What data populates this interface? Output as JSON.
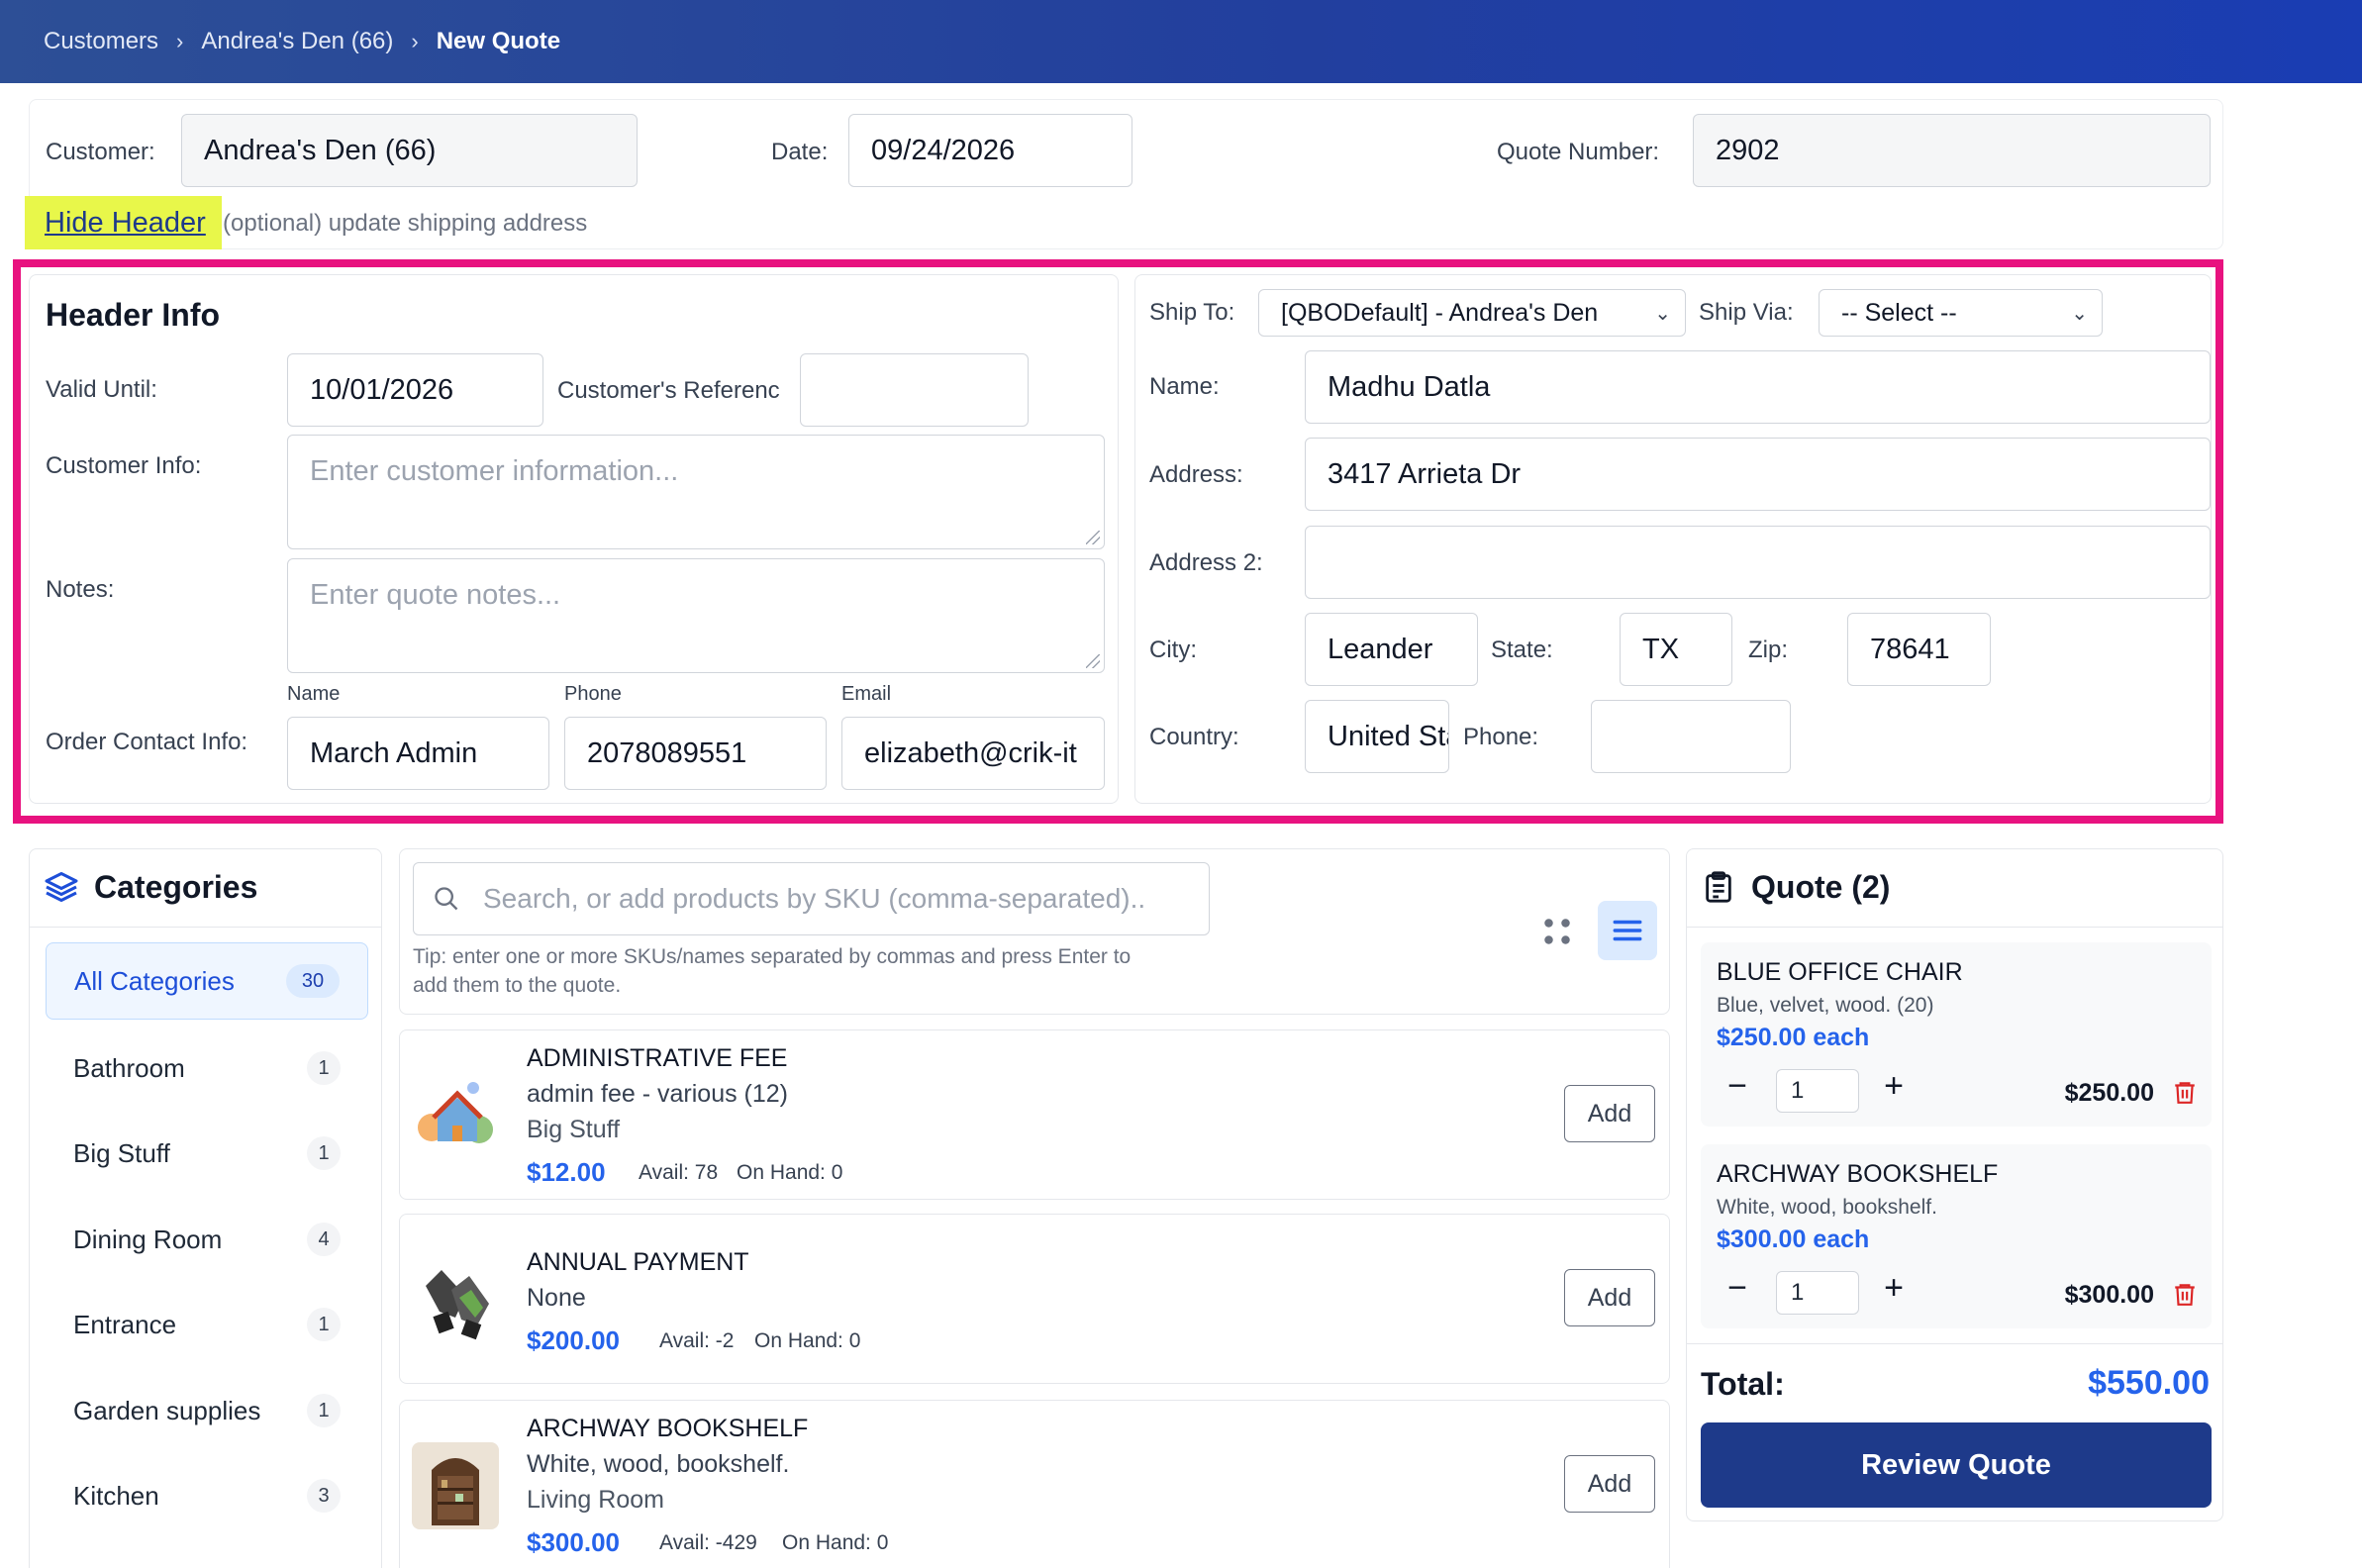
{
  "breadcrumb": [
    "Customers",
    "Andrea's Den (66)",
    "New Quote"
  ],
  "top": {
    "customer_label": "Customer:",
    "customer_value": "Andrea's Den (66)",
    "date_label": "Date:",
    "date_value": "09/24/2026",
    "quote_number_label": "Quote Number:",
    "quote_number_value": "2902",
    "hide_header": "Hide Header",
    "optional_text": "(optional) update shipping address"
  },
  "header_info": {
    "title": "Header Info",
    "valid_until_label": "Valid Until:",
    "valid_until_value": "10/01/2026",
    "customer_ref_label": "Customer's Referenc",
    "customer_ref_value": "",
    "customer_info_label": "Customer Info:",
    "customer_info_placeholder": "Enter customer information...",
    "notes_label": "Notes:",
    "notes_placeholder": "Enter quote notes...",
    "order_contact_label": "Order Contact Info:",
    "name_label": "Name",
    "name_value": "March Admin",
    "phone_label": "Phone",
    "phone_value": "2078089551",
    "email_label": "Email",
    "email_value": "elizabeth@crik-it"
  },
  "shipping": {
    "ship_to_label": "Ship To:",
    "ship_to_value": "[QBODefault] - Andrea's Den",
    "ship_via_label": "Ship Via:",
    "ship_via_value": "-- Select --",
    "name_label": "Name:",
    "name_value": "Madhu Datla",
    "address_label": "Address:",
    "address_value": "3417 Arrieta Dr",
    "address2_label": "Address 2:",
    "address2_value": "",
    "city_label": "City:",
    "city_value": "Leander",
    "state_label": "State:",
    "state_value": "TX",
    "zip_label": "Zip:",
    "zip_value": "78641",
    "country_label": "Country:",
    "country_value": "United States",
    "phone_label": "Phone:",
    "phone_value": ""
  },
  "categories": {
    "title": "Categories",
    "items": [
      {
        "label": "All Categories",
        "count": "30"
      },
      {
        "label": "Bathroom",
        "count": "1"
      },
      {
        "label": "Big Stuff",
        "count": "1"
      },
      {
        "label": "Dining Room",
        "count": "4"
      },
      {
        "label": "Entrance",
        "count": "1"
      },
      {
        "label": "Garden supplies",
        "count": "1"
      },
      {
        "label": "Kitchen",
        "count": "3"
      }
    ]
  },
  "search": {
    "placeholder": "Search, or add products by SKU (comma-separated)..",
    "tip_line1": "Tip: enter one or more SKUs/names separated by commas and press Enter to",
    "tip_line2": "add them to the quote."
  },
  "products": [
    {
      "name": "ADMINISTRATIVE FEE",
      "desc": "admin fee - various (12)",
      "category": "Big Stuff",
      "price": "$12.00",
      "avail": "Avail: 78",
      "on_hand": "On Hand: 0",
      "add": "Add"
    },
    {
      "name": "ANNUAL PAYMENT",
      "desc": "None",
      "category": "",
      "price": "$200.00",
      "avail": "Avail: -2",
      "on_hand": "On Hand: 0",
      "add": "Add"
    },
    {
      "name": "ARCHWAY BOOKSHELF",
      "desc": "White, wood, bookshelf.",
      "category": "Living Room",
      "price": "$300.00",
      "avail": "Avail: -429",
      "on_hand": "On Hand: 0",
      "add": "Add"
    }
  ],
  "quote": {
    "title": "Quote (2)",
    "items": [
      {
        "name": "BLUE OFFICE CHAIR",
        "desc": "Blue, velvet, wood. (20)",
        "price": "$250.00 each",
        "qty": "1",
        "total": "$250.00"
      },
      {
        "name": "ARCHWAY BOOKSHELF",
        "desc": "White, wood, bookshelf.",
        "price": "$300.00 each",
        "qty": "1",
        "total": "$300.00"
      }
    ],
    "total_label": "Total:",
    "total_value": "$550.00",
    "review_button": "Review Quote"
  },
  "colors": {
    "topbar": "#223f9e",
    "accent": "#2563eb",
    "highlight_frame": "#e8127f",
    "hide_header_highlight": "#e8f74a",
    "review_button": "#1e3a8a",
    "trash": "#dc2626"
  }
}
